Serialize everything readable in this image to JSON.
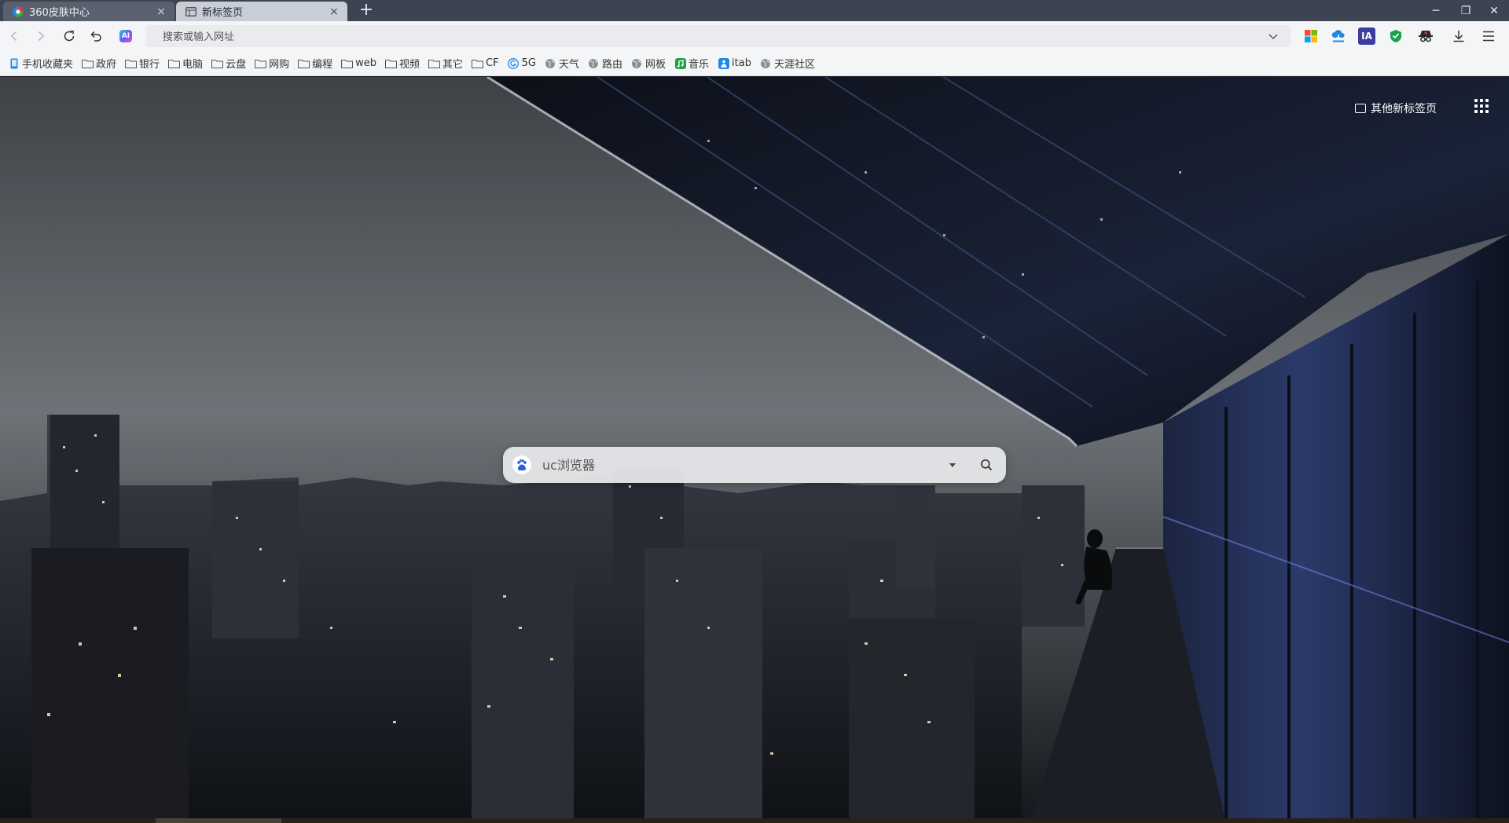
{
  "tabs": [
    {
      "title": "360皮肤中心",
      "close": "×",
      "active": false
    },
    {
      "title": "新标签页",
      "close": "×",
      "active": true
    }
  ],
  "new_tab_label": "+",
  "window_controls": {
    "minimize": "─",
    "restore": "❐",
    "close": "✕"
  },
  "toolbar": {
    "omnibox_placeholder": "搜索或输入网址",
    "ai_label": "AI",
    "extensions": [
      "windows-logo-icon",
      "download-cloud-icon",
      "ia-icon",
      "shield-icon",
      "spy-icon",
      "download-icon",
      "menu-icon"
    ],
    "ia_text": "IA"
  },
  "bookmarks": [
    {
      "label": "手机收藏夹",
      "icon": "phone-icon"
    },
    {
      "label": "政府",
      "icon": "folder-icon"
    },
    {
      "label": "银行",
      "icon": "folder-icon"
    },
    {
      "label": "电脑",
      "icon": "folder-icon"
    },
    {
      "label": "云盘",
      "icon": "folder-icon"
    },
    {
      "label": "网购",
      "icon": "folder-icon"
    },
    {
      "label": "编程",
      "icon": "folder-icon"
    },
    {
      "label": "web",
      "icon": "folder-icon"
    },
    {
      "label": "视频",
      "icon": "folder-icon"
    },
    {
      "label": "其它",
      "icon": "folder-icon"
    },
    {
      "label": "CF",
      "icon": "folder-icon"
    },
    {
      "label": "5G",
      "icon": "5g-icon"
    },
    {
      "label": "天气",
      "icon": "globe-icon"
    },
    {
      "label": "路由",
      "icon": "globe-icon"
    },
    {
      "label": "网板",
      "icon": "globe-icon"
    },
    {
      "label": "音乐",
      "icon": "music-icon"
    },
    {
      "label": "itab",
      "icon": "itab-icon"
    },
    {
      "label": "天涯社区",
      "icon": "globe-icon"
    }
  ],
  "newtab": {
    "other_newtab_label": "其他新标签页",
    "search_placeholder": "uc浏览器"
  },
  "colors": {
    "tabbar": "#3d4451",
    "active_tab": "#c9ced6",
    "toolbar": "#f4f5f7",
    "accent_blue": "#1e88e5"
  }
}
